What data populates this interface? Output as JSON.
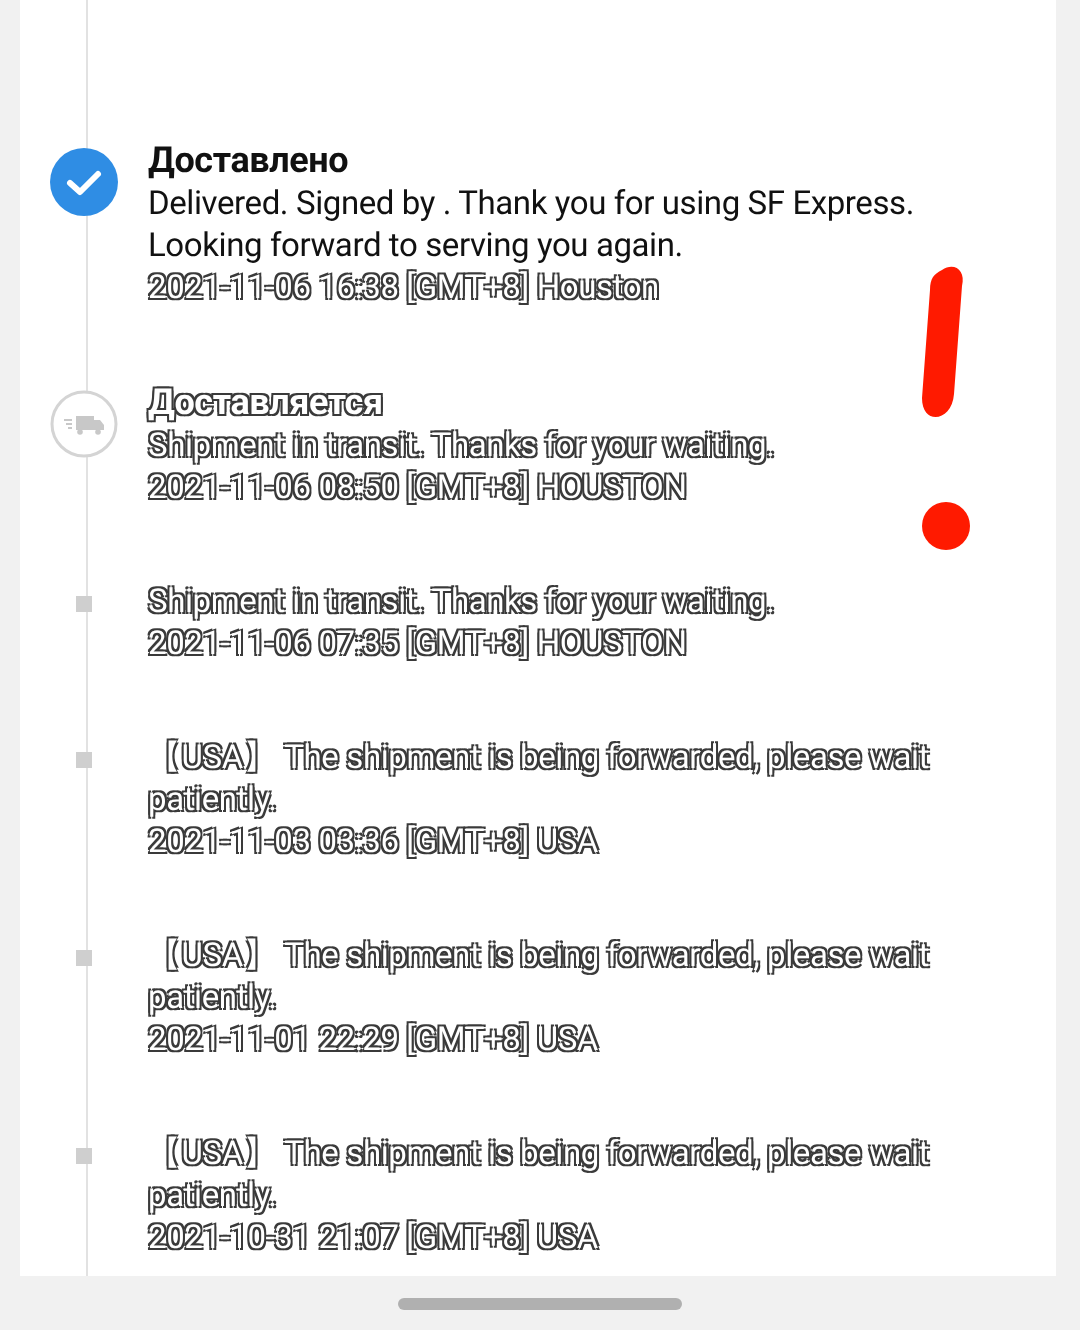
{
  "events": [
    {
      "kind": "delivered",
      "title": "Доставлено",
      "description": "Delivered. Signed by . Thank you for using SF Express. Looking forward to serving you again.",
      "time": "2021-11-06 16:38 [GMT+8] Houston"
    },
    {
      "kind": "in_transit",
      "title": "Доставляется",
      "description": "Shipment in transit. Thanks for your waiting.",
      "time": "2021-11-06 08:50 [GMT+8] HOUSTON"
    },
    {
      "kind": "step",
      "description": "Shipment in transit. Thanks for your waiting.",
      "time": "2021-11-06 07:35 [GMT+8] HOUSTON"
    },
    {
      "kind": "step",
      "description": " 【USA】 The shipment is being forwarded, please wait patiently.",
      "time": "2021-11-03 03:36 [GMT+8] USA"
    },
    {
      "kind": "step",
      "description": " 【USA】 The shipment is being forwarded, please wait patiently.",
      "time": "2021-11-01 22:29 [GMT+8] USA"
    },
    {
      "kind": "step",
      "description": " 【USA】 The shipment is being forwarded, please wait patiently.",
      "time": "2021-10-31 21:07 [GMT+8] USA"
    }
  ]
}
